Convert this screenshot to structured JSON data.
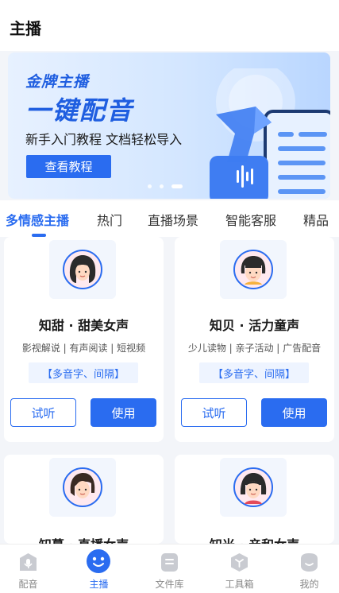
{
  "header": {
    "title": "主播"
  },
  "banner": {
    "brand": "金牌主播",
    "headline": "一键配音",
    "subtitle": "新手入门教程 文档轻松导入",
    "button_label": "查看教程",
    "slide_count": 3,
    "active_slide": 3
  },
  "tabs": [
    "多情感主播",
    "热门",
    "直播场景",
    "智能客服",
    "精品"
  ],
  "cards": [
    {
      "name": "知甜 · 甜美女声",
      "tags": "影视解说 | 有声阅读 | 短视频",
      "feature": "【多音字、间隔】",
      "listen": "试听",
      "use": "使用"
    },
    {
      "name": "知贝 · 活力童声",
      "tags": "少儿读物 | 亲子活动 | 广告配音",
      "feature": "【多音字、间隔】",
      "listen": "试听",
      "use": "使用"
    },
    {
      "name": "知蔓 · 直播女声",
      "tags": "",
      "feature": "",
      "listen": "",
      "use": ""
    },
    {
      "name": "知米 · 亲和女声",
      "tags": "",
      "feature": "",
      "listen": "",
      "use": ""
    }
  ],
  "bottom_nav": [
    {
      "label": "配音",
      "icon": "microphone-icon"
    },
    {
      "label": "主播",
      "icon": "smile-face-icon",
      "active": true
    },
    {
      "label": "文件库",
      "icon": "folder-icon"
    },
    {
      "label": "工具箱",
      "icon": "toolbox-icon"
    },
    {
      "label": "我的",
      "icon": "profile-icon"
    }
  ],
  "colors": {
    "accent": "#2a6cf0",
    "tag_bg": "#eef4ff",
    "page_bg": "#f3f5f9"
  }
}
